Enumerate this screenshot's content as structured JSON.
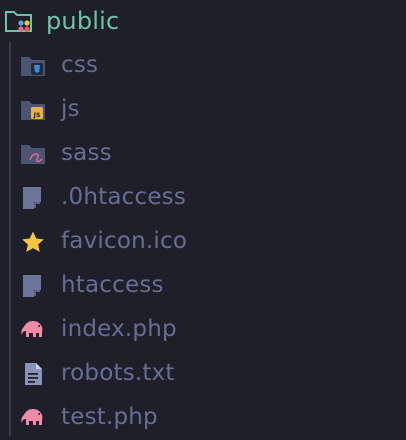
{
  "explorer": {
    "root": {
      "label": "public",
      "icon": "folder-public-icon",
      "color": "#6cc4a7"
    },
    "items": [
      {
        "label": "css",
        "icon": "folder-css-icon",
        "kind": "folder"
      },
      {
        "label": "js",
        "icon": "folder-js-icon",
        "kind": "folder"
      },
      {
        "label": "sass",
        "icon": "folder-sass-icon",
        "kind": "folder"
      },
      {
        "label": ".0htaccess",
        "icon": "file-generic-icon",
        "kind": "file"
      },
      {
        "label": "favicon.ico",
        "icon": "star-icon",
        "kind": "file"
      },
      {
        "label": "htaccess",
        "icon": "file-generic-icon",
        "kind": "file"
      },
      {
        "label": "index.php",
        "icon": "elephant-php-icon",
        "kind": "file"
      },
      {
        "label": "robots.txt",
        "icon": "text-file-icon",
        "kind": "file"
      },
      {
        "label": "test.php",
        "icon": "elephant-php-icon",
        "kind": "file"
      }
    ]
  },
  "colors": {
    "background": "#1e1f29",
    "text": "#686d96",
    "guide": "#3a3c4d",
    "folder": "#4d5373",
    "php": "#f28ba8",
    "star": "#f5c542",
    "js": "#e8b43a",
    "css": "#3a8ad8",
    "sass": "#e06e9b"
  }
}
